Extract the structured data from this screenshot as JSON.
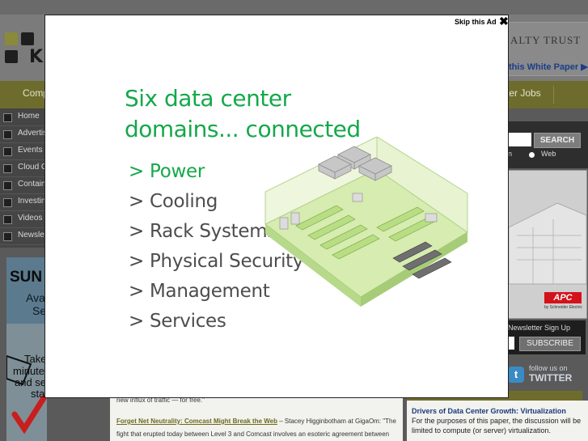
{
  "underlying_page": {
    "logo_text": "KN",
    "top_ad": {
      "brand": "ALTY TRUST",
      "cta": "this White Paper ▶"
    },
    "nav": {
      "items": [
        "Comp",
        "ter Jobs"
      ]
    },
    "left_nav": {
      "items": [
        {
          "label": "Home"
        },
        {
          "label": "Advertis"
        },
        {
          "label": "Events"
        },
        {
          "label": "Cloud C"
        },
        {
          "label": "Contain"
        },
        {
          "label": "Investin"
        },
        {
          "label": "Videos"
        },
        {
          "label": "Newslet"
        }
      ]
    },
    "left_ad": {
      "brand": "SUN",
      "line1": "Ava",
      "line2": "Se",
      "body1": "Take",
      "body2": "minute",
      "body3": "and se",
      "body4": "sta"
    },
    "search": {
      "button": "SEARCH",
      "option_partial": "n",
      "option_web": "Web"
    },
    "apc_ad": {
      "logo": "APC",
      "tagline": "by Schneider Electric"
    },
    "newsletter": {
      "label": "Newsletter Sign Up",
      "button": "SUBSCRIBE"
    },
    "twitter": {
      "line1": "follow us on",
      "line2": "TWITTER"
    },
    "content": {
      "line1": "new influx of traffic — for free.\"",
      "link": "Forget Net Neutrality: Comcast Might Break the Web",
      "byline": " – Stacey Higginbotham at GigaOm: \"The",
      "line3": "fight that erupted today between Level 3 and Comcast involves an esoteric agreement between"
    },
    "right_box": {
      "heading": "Drivers of Data Center Growth: Virtualization",
      "p1": "For the purposes of this paper, the discussion will be",
      "p2": "limited to compute (or server) virtualization."
    }
  },
  "modal": {
    "skip_label": "Skip this Ad",
    "close_glyph": "✖",
    "title_line1": "Six data center",
    "title_line2": "domains... connected",
    "items": [
      "> Power",
      "> Cooling",
      "> Rack Systems",
      "> Physical Security",
      "> Management",
      "> Services"
    ],
    "accent_color": "#15a84a",
    "text_color": "#4d4d4d"
  }
}
